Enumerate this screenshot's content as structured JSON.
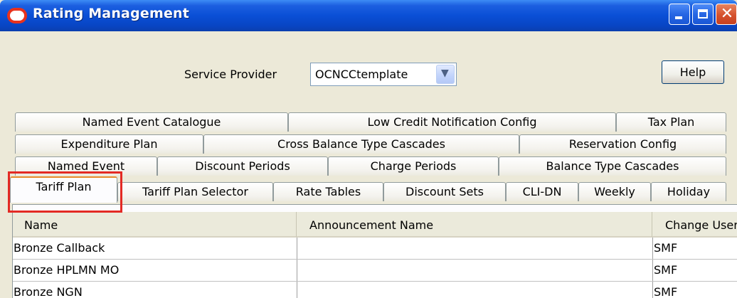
{
  "window": {
    "title": "Rating Management",
    "icon": "oracle-logo-icon",
    "close_glyph": "✕"
  },
  "toolbar": {
    "service_provider_label": "Service Provider",
    "service_provider_value": "OCNCCtemplate",
    "dropdown_glyph": "▼",
    "help_label": "Help"
  },
  "tabs": {
    "row1": [
      "Named Event Catalogue",
      "Low Credit Notification Config",
      "Tax Plan"
    ],
    "row2": [
      "Expenditure Plan",
      "Cross Balance Type Cascades",
      "Reservation Config"
    ],
    "row3": [
      "Named Event",
      "Discount Periods",
      "Charge Periods",
      "Balance Type Cascades"
    ],
    "row4": [
      "Tariff Plan",
      "Tariff Plan Selector",
      "Rate Tables",
      "Discount Sets",
      "CLI-DN",
      "Weekly",
      "Holiday"
    ],
    "active": "Tariff Plan"
  },
  "table": {
    "columns": [
      "Name",
      "Announcement Name",
      "Change User"
    ],
    "rows": [
      [
        "Bronze Callback",
        "",
        "SMF"
      ],
      [
        "Bronze HPLMN MO",
        "",
        "SMF"
      ],
      [
        "Bronze NGN",
        "",
        "SMF"
      ]
    ]
  },
  "colors": {
    "titlebar": "#0a4fd6",
    "highlight": "#e32a24",
    "active_tab_accent": "#e68b2c"
  }
}
